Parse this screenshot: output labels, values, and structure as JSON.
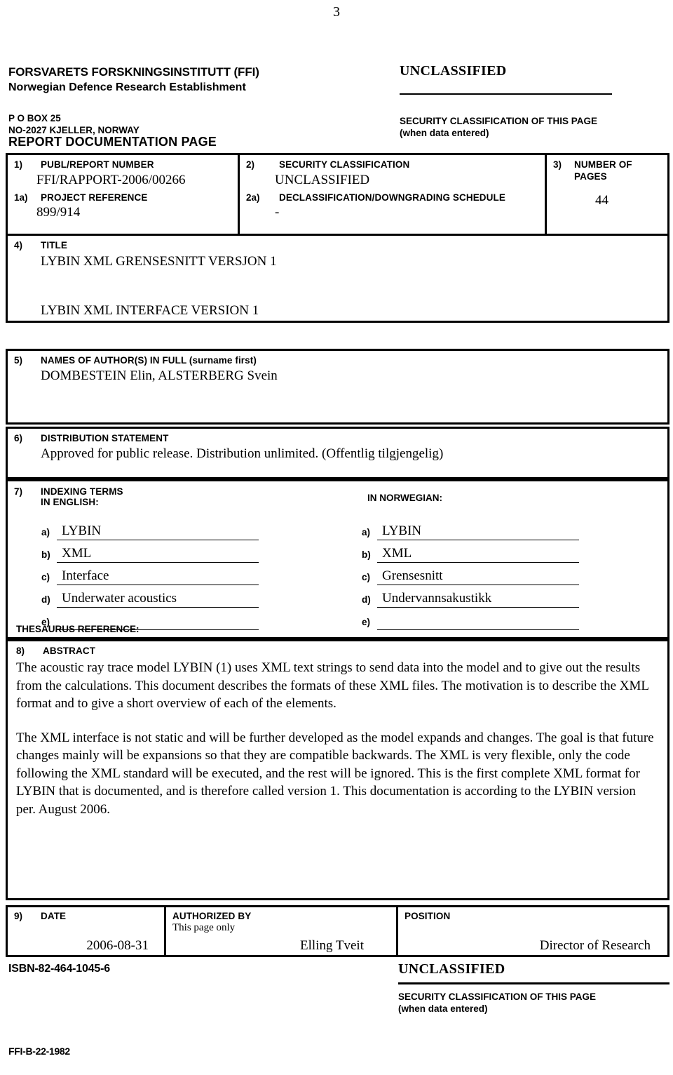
{
  "page_number": "3",
  "header": {
    "org_name": "FORSVARETS FORSKNINGSINSTITUTT (FFI)",
    "org_name_en": "Norwegian Defence Research Establishment",
    "address_line1": "P O BOX 25",
    "address_line2": "NO-2027 KJELLER, NORWAY",
    "form_title": "REPORT DOCUMENTATION PAGE",
    "classification": "UNCLASSIFIED",
    "security_note_line1": "SECURITY CLASSIFICATION OF THIS PAGE",
    "security_note_line2": "(when data entered)"
  },
  "fields": {
    "publ_report_number": {
      "num": "1)",
      "label": "PUBL/REPORT NUMBER",
      "value": "FFI/RAPPORT-2006/00266"
    },
    "project_reference": {
      "num": "1a)",
      "label": "PROJECT REFERENCE",
      "value": "899/914"
    },
    "security_classification": {
      "num": "2)",
      "label": "SECURITY CLASSIFICATION",
      "value": "UNCLASSIFIED"
    },
    "declassification": {
      "num": "2a)",
      "label": "DECLASSIFICATION/DOWNGRADING SCHEDULE",
      "value": "-"
    },
    "number_of_pages": {
      "num": "3)",
      "label_line1": "NUMBER OF",
      "label_line2": "PAGES",
      "value": "44"
    },
    "title": {
      "num": "4)",
      "label": "TITLE",
      "value_no": "LYBIN XML GRENSESNITT VERSJON 1",
      "value_en": "LYBIN XML INTERFACE VERSION 1"
    },
    "authors": {
      "num": "5)",
      "label": "NAMES OF AUTHOR(S) IN FULL (surname first)",
      "value": "DOMBESTEIN Elin, ALSTERBERG Svein"
    },
    "distribution": {
      "num": "6)",
      "label": "DISTRIBUTION STATEMENT",
      "value": "Approved for public release. Distribution unlimited. (Offentlig tilgjengelig)"
    },
    "indexing": {
      "num": "7)",
      "label_line1": "INDEXING TERMS",
      "label_line2": "IN ENGLISH:",
      "label_norwegian": "IN NORWEGIAN:",
      "thesaurus_label": "THESAURUS REFERENCE:",
      "letters": [
        "a)",
        "b)",
        "c)",
        "d)",
        "e)"
      ],
      "english": [
        "LYBIN",
        "XML",
        "Interface",
        "Underwater acoustics",
        ""
      ],
      "norwegian": [
        "LYBIN",
        "XML",
        "Grensesnitt",
        "Undervannsakustikk",
        ""
      ]
    },
    "abstract": {
      "num": "8)",
      "label": "ABSTRACT",
      "paragraph1": "The acoustic ray trace model LYBIN (1) uses XML text strings to send data into the model and to give out the results from the calculations. This document describes the formats of these XML files. The motivation is to describe the XML format and to give a short overview of each of the elements.",
      "paragraph2": "The XML interface is not static and will be further developed as the model expands and changes. The goal is that future changes mainly will be expansions so that they are compatible backwards. The XML is very flexible, only the code following the XML standard will be executed, and the rest will be ignored. This is the first complete XML format for LYBIN that is documented, and is therefore called version 1. This documentation is according to the LYBIN version per. August 2006."
    },
    "date": {
      "num": "9)",
      "label": "DATE",
      "value": "2006-08-31"
    },
    "authorized_by": {
      "label": "AUTHORIZED BY",
      "sublabel": "This page only",
      "value": "Elling Tveit"
    },
    "position": {
      "label": "POSITION",
      "value": "Director of Research"
    }
  },
  "footer": {
    "isbn": "ISBN-82-464-1045-6",
    "classification": "UNCLASSIFIED",
    "security_note_line1": "SECURITY CLASSIFICATION OF THIS PAGE",
    "security_note_line2": "(when data entered)",
    "form_code": "FFI-B-22-1982"
  }
}
